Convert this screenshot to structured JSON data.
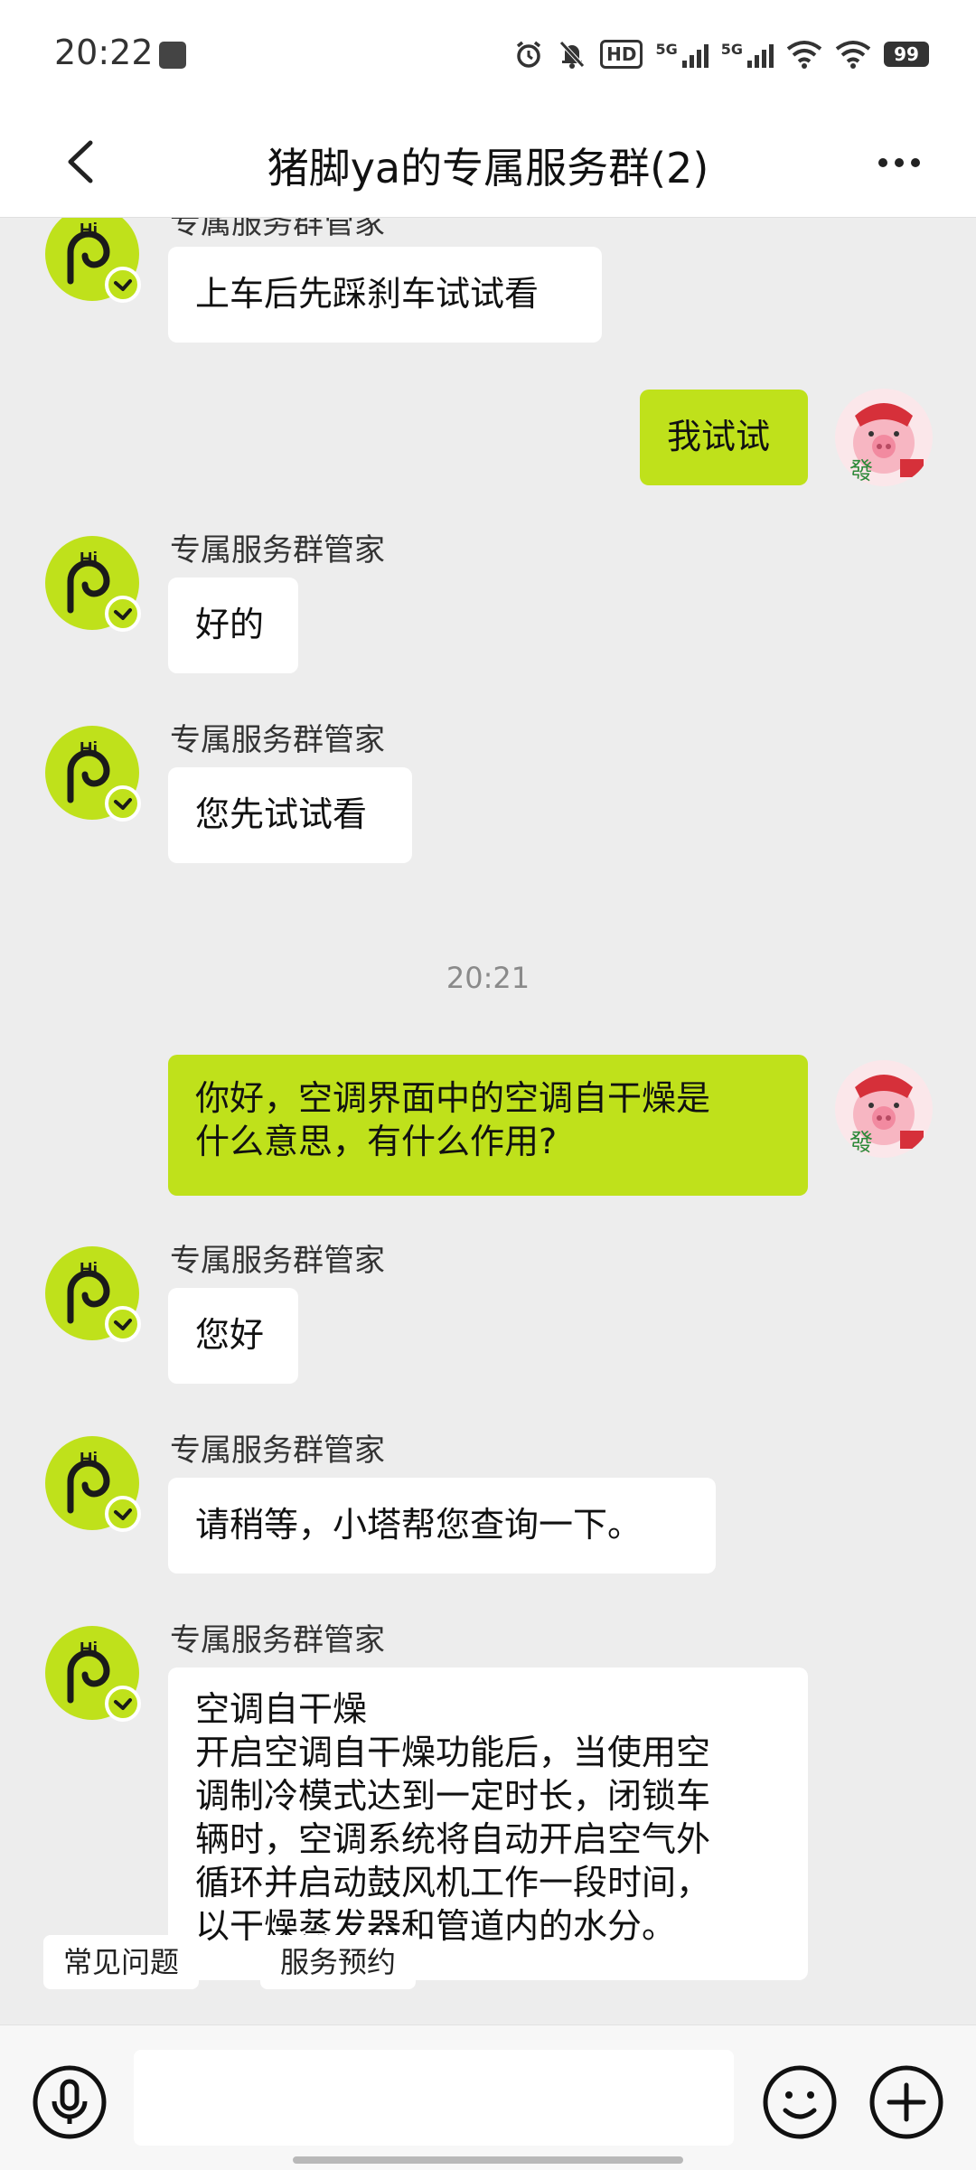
{
  "status_bar": {
    "time": "20:22",
    "signal1_label": "5G",
    "signal2_label": "5G",
    "hd_label": "HD",
    "battery": "99"
  },
  "header": {
    "title": "猪脚ya的专属服务群(2)"
  },
  "messages": [
    {
      "sender": "专属服务群管家",
      "text": "上车后先踩刹车试试看"
    },
    {
      "text": "我试试"
    },
    {
      "sender": "专属服务群管家",
      "text": "好的"
    },
    {
      "sender": "专属服务群管家",
      "text": "您先试试看"
    },
    {
      "timestamp": "20:21"
    },
    {
      "text": "你好，空调界面中的空调自干燥是\n什么意思，有什么作用?"
    },
    {
      "sender": "专属服务群管家",
      "text": "您好"
    },
    {
      "sender": "专属服务群管家",
      "text": "请稍等，小塔帮您查询一下。"
    },
    {
      "sender": "专属服务群管家",
      "text": "空调自干燥\n开启空调自干燥功能后，当使用空\n调制冷模式达到一定时长，闭锁车\n辆时，空调系统将自动开启空气外\n循环并启动鼓风机工作一段时间，\n以干燥蒸发器和管道内的水分。"
    }
  ],
  "bot_avatar_text": "Hi",
  "user_avatar_text": "發",
  "quick_replies": [
    "常见问题",
    "服务预约"
  ],
  "input": {
    "placeholder": ""
  },
  "colors": {
    "accent": "#bfe11b",
    "background": "#ededed"
  }
}
